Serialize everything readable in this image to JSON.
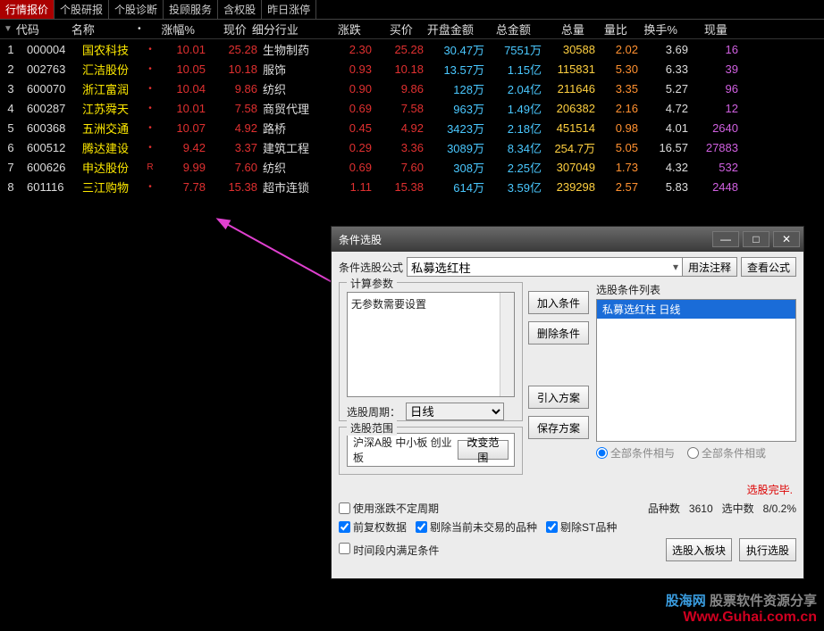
{
  "menubar": {
    "tabs": [
      "行情报价",
      "个股研报",
      "个股诊断",
      "投顾服务",
      "含权股",
      "昨日涨停"
    ]
  },
  "columns": [
    "",
    "代码",
    "名称",
    "",
    "涨幅%",
    "现价",
    "细分行业",
    "涨跌",
    "买价",
    "开盘金额",
    "总金额",
    "总量",
    "量比",
    "换手%",
    "现量"
  ],
  "rows": [
    {
      "idx": "1",
      "code": "000004",
      "name": "国农科技",
      "dot": "•",
      "chgp": "10.01",
      "price": "25.28",
      "ind": "生物制药",
      "chg": "2.30",
      "bid": "25.28",
      "open": "30.47万",
      "tot": "7551万",
      "vol": "30588",
      "rat": "2.02",
      "turn": "3.69",
      "holds": "16"
    },
    {
      "idx": "2",
      "code": "002763",
      "name": "汇洁股份",
      "dot": "•",
      "chgp": "10.05",
      "price": "10.18",
      "ind": "服饰",
      "chg": "0.93",
      "bid": "10.18",
      "open": "13.57万",
      "tot": "1.15亿",
      "vol": "115831",
      "rat": "5.30",
      "turn": "6.33",
      "holds": "39"
    },
    {
      "idx": "3",
      "code": "600070",
      "name": "浙江富润",
      "dot": "•",
      "chgp": "10.04",
      "price": "9.86",
      "ind": "纺织",
      "chg": "0.90",
      "bid": "9.86",
      "open": "128万",
      "tot": "2.04亿",
      "vol": "211646",
      "rat": "3.35",
      "turn": "5.27",
      "holds": "96"
    },
    {
      "idx": "4",
      "code": "600287",
      "name": "江苏舜天",
      "dot": "•",
      "chgp": "10.01",
      "price": "7.58",
      "ind": "商贸代理",
      "chg": "0.69",
      "bid": "7.58",
      "open": "963万",
      "tot": "1.49亿",
      "vol": "206382",
      "rat": "2.16",
      "turn": "4.72",
      "holds": "12"
    },
    {
      "idx": "5",
      "code": "600368",
      "name": "五洲交通",
      "dot": "•",
      "chgp": "10.07",
      "price": "4.92",
      "ind": "路桥",
      "chg": "0.45",
      "bid": "4.92",
      "open": "3423万",
      "tot": "2.18亿",
      "vol": "451514",
      "rat": "0.98",
      "turn": "4.01",
      "holds": "2640"
    },
    {
      "idx": "6",
      "code": "600512",
      "name": "腾达建设",
      "dot": "•",
      "chgp": "9.42",
      "price": "3.37",
      "ind": "建筑工程",
      "chg": "0.29",
      "bid": "3.36",
      "open": "3089万",
      "tot": "8.34亿",
      "vol": "254.7万",
      "rat": "5.05",
      "turn": "16.57",
      "holds": "27883"
    },
    {
      "idx": "7",
      "code": "600626",
      "name": "申达股份",
      "dot": "R",
      "chgp": "9.99",
      "price": "7.60",
      "ind": "纺织",
      "chg": "0.69",
      "bid": "7.60",
      "open": "308万",
      "tot": "2.25亿",
      "vol": "307049",
      "rat": "1.73",
      "turn": "4.32",
      "holds": "532"
    },
    {
      "idx": "8",
      "code": "601116",
      "name": "三江购物",
      "dot": "•",
      "chgp": "7.78",
      "price": "15.38",
      "ind": "超市连锁",
      "chg": "1.11",
      "bid": "15.38",
      "open": "614万",
      "tot": "3.59亿",
      "vol": "239298",
      "rat": "2.57",
      "turn": "5.83",
      "holds": "2448"
    }
  ],
  "dialog": {
    "title": "条件选股",
    "formula_label": "条件选股公式",
    "formula_value": "私募选红柱",
    "btn_usage": "用法注释",
    "btn_view": "查看公式",
    "params_label": "计算参数",
    "params_empty": "无参数需要设置",
    "period_label": "选股周期：",
    "period_value": "日线",
    "range_label": "选股范围",
    "range_text": "沪深A股 中小板 创业板",
    "btn_range": "改变范围",
    "btn_add": "加入条件",
    "btn_del": "删除条件",
    "btn_load": "引入方案",
    "btn_save": "保存方案",
    "cond_list_label": "选股条件列表",
    "cond_item": "私募选红柱   日线",
    "radio_and": "全部条件相与",
    "radio_or": "全部条件相或",
    "done": "选股完毕.",
    "chk_period": "使用涨跌不定周期",
    "stat1_label": "品种数",
    "stat1_val": "3610",
    "stat2_label": "选中数",
    "stat2_val": "8/0.2%",
    "chk_qfq": "前复权数据",
    "chk_notrade": "剔除当前未交易的品种",
    "chk_st": "剔除ST品种",
    "chk_time": "时间段内满足条件",
    "btn_block": "选股入板块",
    "btn_run": "执行选股"
  },
  "watermark": {
    "line1a": "股海网",
    "line1b": "股票软件资源分享",
    "line2": "Www.Guhai.com.cn"
  }
}
